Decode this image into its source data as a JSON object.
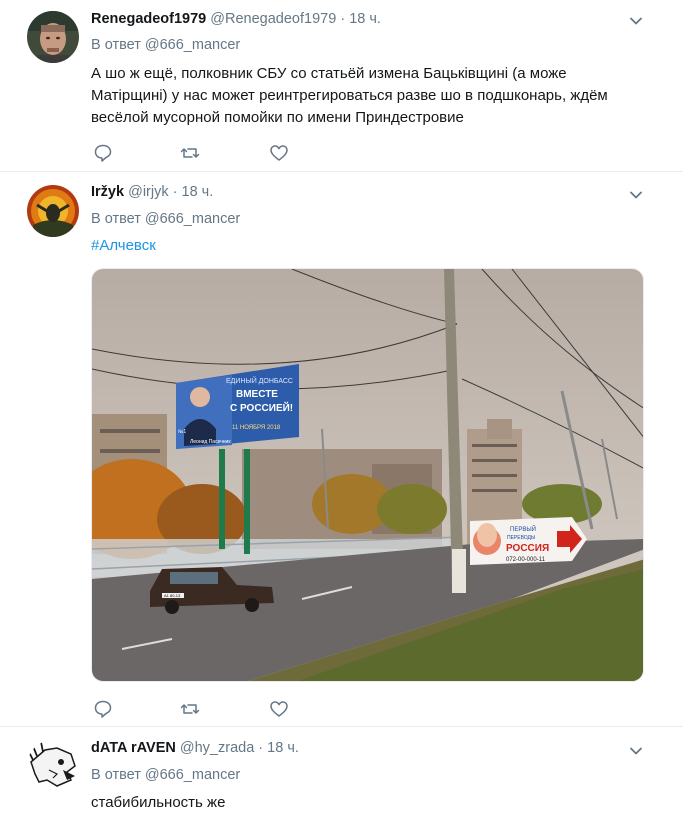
{
  "tweets": [
    {
      "name": "Renegadeof1979",
      "handle": "@Renegadeof1979",
      "time": "18 ч.",
      "reply_prefix": "В ответ",
      "reply_to": "@666_mancer",
      "text": "А шо ж ещё, полковник СБУ со статьёй измена Бацьківщині (а може Матірщині) у нас может реинтрегироваться разве шо в подшконарь, ждём весёлой мусорной помойки по имени Приндестровие"
    },
    {
      "name": "Iržyk",
      "handle": "@irjyk",
      "time": "18 ч.",
      "reply_prefix": "В ответ",
      "reply_to": "@666_mancer",
      "hashtag": "#Алчевск",
      "photo": {
        "billboard_left": {
          "line1": "ЕДИНЫЙ ДОНБАСС",
          "line2": "ВМЕСТЕ",
          "line3": "С РОССИЕЙ!",
          "date": "11 НОЯБРЯ 2018",
          "name": "Леонид Пасечник",
          "number": "№1"
        },
        "billboard_right": {
          "line1": "ПЕРВЫЙ",
          "line2": "ПЕРЕВОДЫ",
          "line3": "РОССИЯ",
          "phone": "072-00-000-11"
        },
        "car_plate": "А1 80-13"
      }
    },
    {
      "name": "dATA rAVEN",
      "handle": "@hy_zrada",
      "time": "18 ч.",
      "reply_prefix": "В ответ",
      "reply_to": "@666_mancer",
      "text": "стабибильность же"
    }
  ],
  "separator": "·",
  "colors": {
    "link": "#1b95e0",
    "secondary": "#657786",
    "icon": "#657786",
    "divider": "#e6ecf0"
  }
}
